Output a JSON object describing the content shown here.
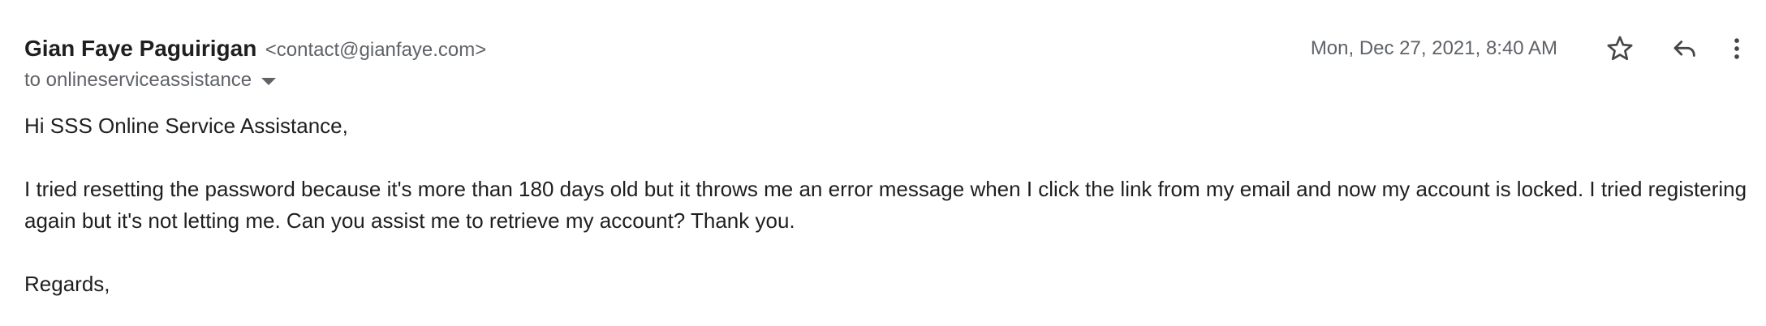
{
  "message": {
    "sender_name": "Gian Faye Paguirigan",
    "sender_email": "<contact@gianfaye.com>",
    "recipient_line": "to onlineserviceassistance",
    "date": "Mon, Dec 27, 2021, 8:40 AM",
    "actions": {
      "star_icon": "star-icon",
      "reply_icon": "reply-icon",
      "more_icon": "more-vert-icon"
    },
    "body": {
      "greeting": "Hi SSS Online Service Assistance,",
      "paragraph": "I tried resetting the password because it's more than 180 days old but it throws me an error message when I click the link from my email and now my account is locked. I tried registering again but it's not letting me. Can you assist me to retrieve my account? Thank you.",
      "closing": "Regards,"
    }
  }
}
